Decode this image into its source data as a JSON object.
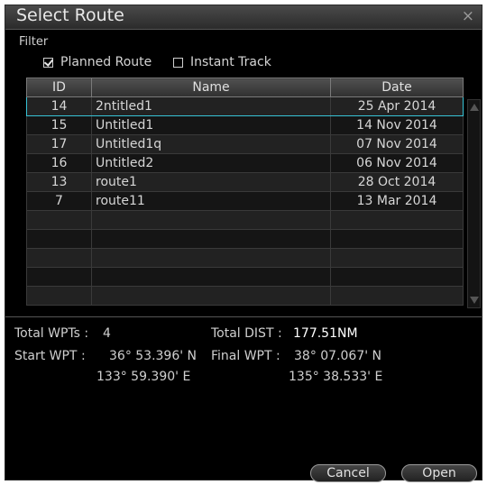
{
  "dialog": {
    "title": "Select Route",
    "close_glyph": "×",
    "filter_label": "Filter",
    "filters": [
      {
        "label": "Planned Route",
        "checked": true
      },
      {
        "label": "Instant Track",
        "checked": false
      }
    ]
  },
  "table": {
    "columns": [
      "ID",
      "Name",
      "Date"
    ],
    "selected_index": 0,
    "rows": [
      {
        "id": "14",
        "name": "2ntitled1",
        "date": "25 Apr 2014"
      },
      {
        "id": "15",
        "name": "Untitled1",
        "date": "14 Nov 2014"
      },
      {
        "id": "17",
        "name": "Untitled1q",
        "date": "07 Nov 2014"
      },
      {
        "id": "16",
        "name": "Untitled2",
        "date": "06 Nov 2014"
      },
      {
        "id": "13",
        "name": "route1",
        "date": "28 Oct 2014"
      },
      {
        "id": "7",
        "name": "route11",
        "date": "13 Mar 2014"
      }
    ],
    "empty_rows": 5
  },
  "info": {
    "total_wpts_label": "Total WPTs :",
    "total_wpts_value": "4",
    "total_dist_label": "Total DIST :",
    "total_dist_value": "177.51NM",
    "start_wpt_label": "Start WPT :",
    "start_wpt_lat": "36° 53.396' N",
    "start_wpt_lon": "133° 59.390' E",
    "final_wpt_label": "Final WPT :",
    "final_wpt_lat": "38° 07.067' N",
    "final_wpt_lon": "135° 38.533' E"
  },
  "buttons": {
    "cancel": "Cancel",
    "open": "Open"
  }
}
